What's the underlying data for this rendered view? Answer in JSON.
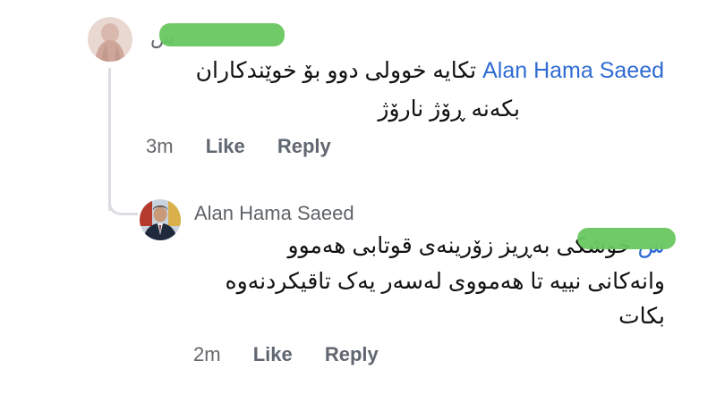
{
  "comment": {
    "author_visible": "س",
    "mention": "Alan Hama Saeed",
    "text_line1": "تکایە خوولی دوو بۆ خوێندکاران",
    "text_line2": "بکەنە ڕۆژ نارۆژ",
    "time": "3m",
    "like_label": "Like",
    "reply_label": "Reply"
  },
  "reply": {
    "author": "Alan Hama Saeed",
    "mention_visible": "س",
    "text_line1": "خوشکی بەڕیز زۆرینەی قوتابی هەموو",
    "text_line2": "وانەکانی نییە تا هەمووی لەسەر یەک تاقیکردنەوە",
    "text_line3": "بکات",
    "time": "2m",
    "like_label": "Like",
    "reply_label": "Reply"
  },
  "colors": {
    "mention": "#2f6bd3",
    "redaction": "#69c760",
    "meta": "#606770",
    "thread_line": "#dcdde2"
  }
}
